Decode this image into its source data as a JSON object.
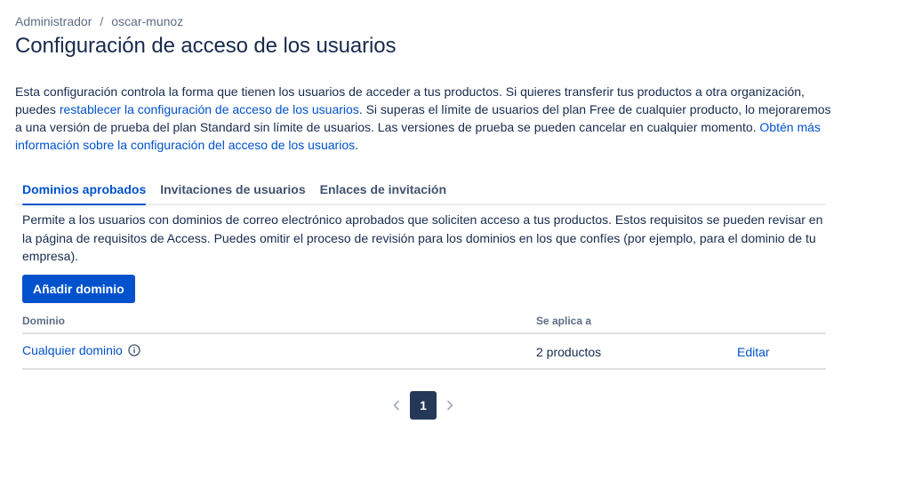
{
  "breadcrumb": {
    "items": [
      "Administrador",
      "oscar-munoz"
    ],
    "separator": "/"
  },
  "page_title": "Configuración de acceso de los usuarios",
  "intro": {
    "text1": "Esta configuración controla la forma que tienen los usuarios de acceder a tus productos. Si quieres transferir tus productos a otra organización, puedes ",
    "link1": "restablecer la configuración de acceso de los usuarios",
    "text2": ". Si superas el límite de usuarios del plan Free de cualquier producto, lo mejoraremos a una versión de prueba del plan Standard sin límite de usuarios. Las versiones de prueba se pueden cancelar en cualquier momento. ",
    "link2": "Obtén más información sobre la configuración del acceso de los usuarios",
    "text3": "."
  },
  "tabs": [
    {
      "label": "Dominios aprobados",
      "active": true
    },
    {
      "label": "Invitaciones de usuarios",
      "active": false
    },
    {
      "label": "Enlaces de invitación",
      "active": false
    }
  ],
  "tab_description": "Permite a los usuarios con dominios de correo electrónico aprobados que soliciten acceso a tus productos. Estos requisitos se pueden revisar en la página de requisitos de Access. Puedes omitir el proceso de revisión para los dominios en los que confíes (por ejemplo, para el dominio de tu empresa).",
  "add_domain_button": "Añadir dominio",
  "table": {
    "headers": {
      "domain": "Dominio",
      "applies_to": "Se aplica a"
    },
    "rows": [
      {
        "domain": "Cualquier dominio",
        "applies_to": "2 productos",
        "action": "Editar"
      }
    ]
  },
  "pagination": {
    "current_page": "1"
  },
  "colors": {
    "accent": "#0052cc",
    "text": "#172b4d",
    "page_active": "#253858"
  }
}
